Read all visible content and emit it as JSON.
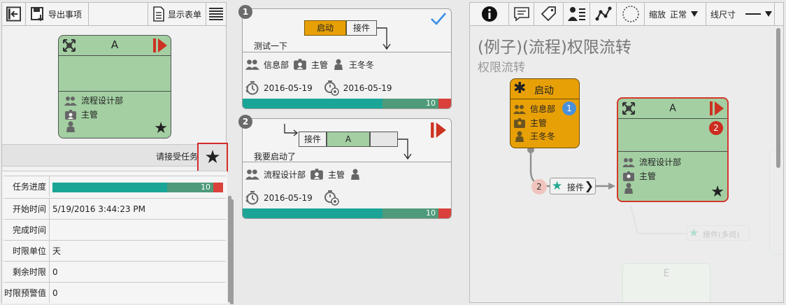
{
  "left": {
    "toolbar": {
      "export_label": "导出事项",
      "show_form_label": "显示表单"
    },
    "node": {
      "title": "A",
      "department": "流程设计部",
      "role": "主管"
    },
    "accept_label": "请接受任务",
    "properties": [
      {
        "key": "任务进度",
        "value": ""
      },
      {
        "key": "开始时间",
        "value": "5/19/2016 3:44:23 PM"
      },
      {
        "key": "完成时间",
        "value": ""
      },
      {
        "key": "时限单位",
        "value": "天"
      },
      {
        "key": "剩余时限",
        "value": "0"
      },
      {
        "key": "时限预警值",
        "value": "0"
      }
    ],
    "progress": {
      "label": "10",
      "value": 10
    }
  },
  "middle": {
    "cards": [
      {
        "badge": "1",
        "flow_from": "启动",
        "flow_to": "接件",
        "note": "测试一下",
        "department": "信息部",
        "role": "主管",
        "person": "王冬冬",
        "start_date": "2016-05-19",
        "end_date": "2016-05-19",
        "progress_label": "10"
      },
      {
        "badge": "2",
        "flow_from": "接件",
        "flow_to": "A",
        "note": "我要启动了",
        "department": "流程设计部",
        "role": "主管",
        "person": "",
        "start_date": "2016-05-19",
        "end_date": "",
        "progress_label": "10"
      }
    ]
  },
  "right": {
    "toolbar": {
      "zoom_label": "缩放",
      "zoom_value": "正常",
      "line_size_label": "线尺寸"
    },
    "title": "(例子)(流程)权限流转",
    "subtitle": "权限流转",
    "start_node": {
      "title": "启动",
      "department": "信息部",
      "badge": "1",
      "role": "主管",
      "person": "王冬冬"
    },
    "connector": {
      "badge": "2",
      "label": "接件"
    },
    "node_a": {
      "title": "A",
      "badge": "2",
      "department": "流程设计部",
      "role": "主管"
    },
    "faded_label": "接件(多岗)",
    "faded_node_title": "E"
  },
  "colors": {
    "node_green": "#a3cfa2",
    "start_orange": "#e8a007",
    "teal": "#1aa597",
    "red": "#d9413a",
    "blue_badge": "#4a90d9",
    "selected_border": "#d23a2c"
  },
  "icons": [
    "back-icon",
    "save-export-icon",
    "form-icon",
    "list-icon",
    "process-icon",
    "play-step-icon",
    "people-icon",
    "badge-icon",
    "person-icon",
    "star-icon",
    "check-icon",
    "timer-start-icon",
    "timer-end-icon",
    "info-icon",
    "comment-icon",
    "tag-icon",
    "users-list-icon",
    "graph-icon",
    "circle-dashed-icon",
    "dropdown-icon"
  ]
}
